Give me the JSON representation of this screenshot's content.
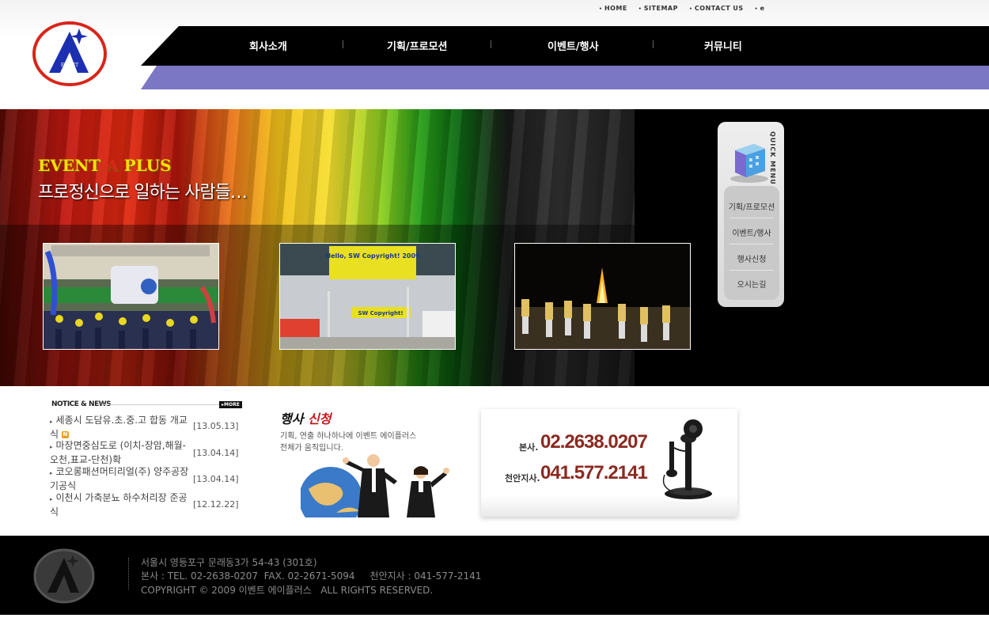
{
  "util_nav": [
    "HOME",
    "SITEMAP",
    "CONTACT US",
    "e"
  ],
  "logo_text": "EVENT",
  "gnb": [
    "회사소개",
    "기획/프로모션",
    "이벤트/행사",
    "커뮤니티"
  ],
  "hero": {
    "brand_part1": "EVENT",
    "brand_a": "A",
    "brand_part2": "PLUS",
    "tagline": "프로정신으로 일하는 사람들…",
    "photo2_sign": "Hello, SW Copyright! 2009",
    "photo2_banner": "SW Copyright!"
  },
  "quick_menu": {
    "title": "QUICK MENU",
    "items": [
      "기획/프로모션",
      "이벤트/행사",
      "행사신청",
      "오시는길"
    ]
  },
  "notice": {
    "title": "NOTICE & NEWS",
    "more": "MORE",
    "items": [
      {
        "title": "세종시 도담유.초.중.고 합동 개교식",
        "date": "[13.05.13]",
        "new": "N"
      },
      {
        "title": "마장면중심도로 (이치-장암,해월-오천,표교-단천)확",
        "date": "[13.04.14]"
      },
      {
        "title": "코오롱패션머티리얼(주) 양주공장 기공식",
        "date": "[13.04.14]"
      },
      {
        "title": "이천시 가축분뇨 하수처리장 준공식",
        "date": "[12.12.22]"
      }
    ]
  },
  "event_banner": {
    "title_black": "행사",
    "title_red": "신청",
    "desc_line1": "기획, 연출 하나하나에 이벤트 에이플러스",
    "desc_line2": "전체가 움직입니다."
  },
  "phone_banner": {
    "hq_label": "본사.",
    "hq_number": "02.2638.0207",
    "branch_label": "천안지사.",
    "branch_number": "041.577.2141"
  },
  "footer": {
    "address": "서울시 영등포구 문래동3가 54-43 (301호)",
    "contact": "본사 : TEL. 02-2638-0207  FAX. 02-2671-5094     천안지사 : 041-577-2141",
    "copyright": "COPYRIGHT © 2009 이벤트 에이플러스   ALL RIGHTS RESERVED."
  },
  "colors": {
    "purple_bar": "#7b77c4",
    "nav_black": "#000000",
    "logo_red": "#d8251a",
    "logo_blue": "#1b2fb0",
    "phone_number": "#8a2a20",
    "brand_yellow": "#f4e000"
  }
}
